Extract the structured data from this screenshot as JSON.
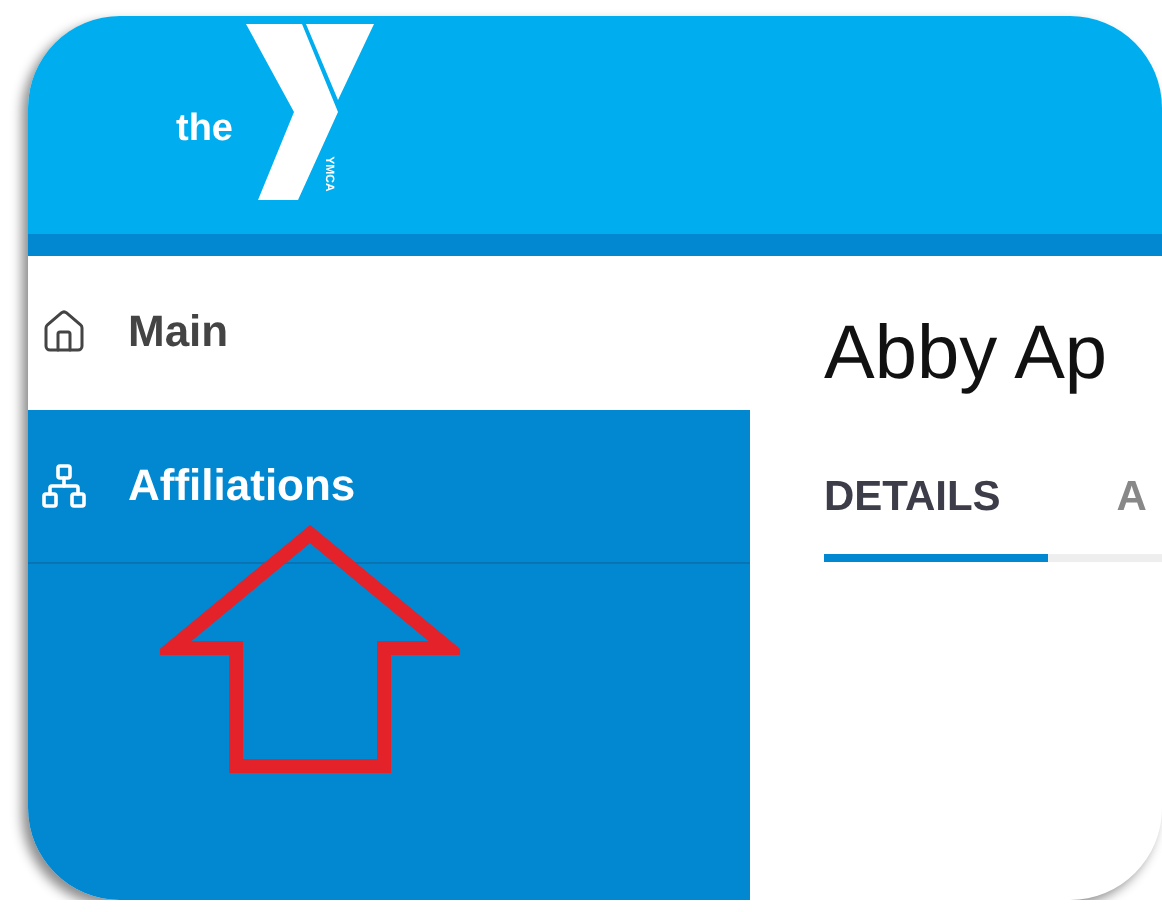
{
  "logo": {
    "word": "the",
    "mark": "YMCA"
  },
  "sidebar": {
    "items": [
      {
        "label": "Main",
        "kind": "home",
        "selected": false
      },
      {
        "label": "Affiliations",
        "kind": "hierarchy",
        "selected": true
      }
    ]
  },
  "content": {
    "title": "Abby Ap",
    "tabs": [
      {
        "label": "DETAILS",
        "selected": true
      },
      {
        "label": "A",
        "selected": false
      }
    ]
  }
}
